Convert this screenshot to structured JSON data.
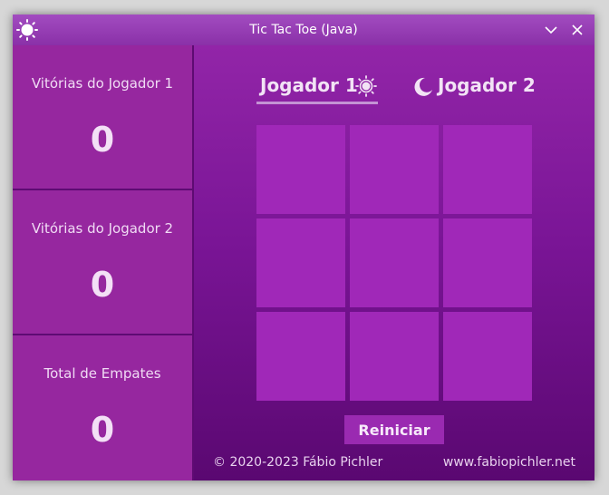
{
  "window": {
    "title": "Tic Tac Toe (Java)",
    "app_icon": "sun-icon"
  },
  "sidebar": {
    "stats": [
      {
        "label": "Vitórias do Jogador 1",
        "value": "0"
      },
      {
        "label": "Vitórias do Jogador 2",
        "value": "0"
      },
      {
        "label": "Total de Empates",
        "value": "0"
      }
    ]
  },
  "players": [
    {
      "name": "Jogador 1",
      "icon": "sun-icon",
      "active": true
    },
    {
      "name": "Jogador 2",
      "icon": "moon-icon",
      "active": false
    }
  ],
  "board": {
    "cells": [
      "",
      "",
      "",
      "",
      "",
      "",
      "",
      "",
      ""
    ]
  },
  "actions": {
    "reset_label": "Reiniciar"
  },
  "footer": {
    "copyright": "© 2020-2023 Fábio Pichler",
    "website": "www.fabiopichler.net"
  },
  "colors": {
    "accent": "#9a2ab1",
    "board_cell": "#a028b8",
    "sidebar_panel": "#96279f"
  }
}
